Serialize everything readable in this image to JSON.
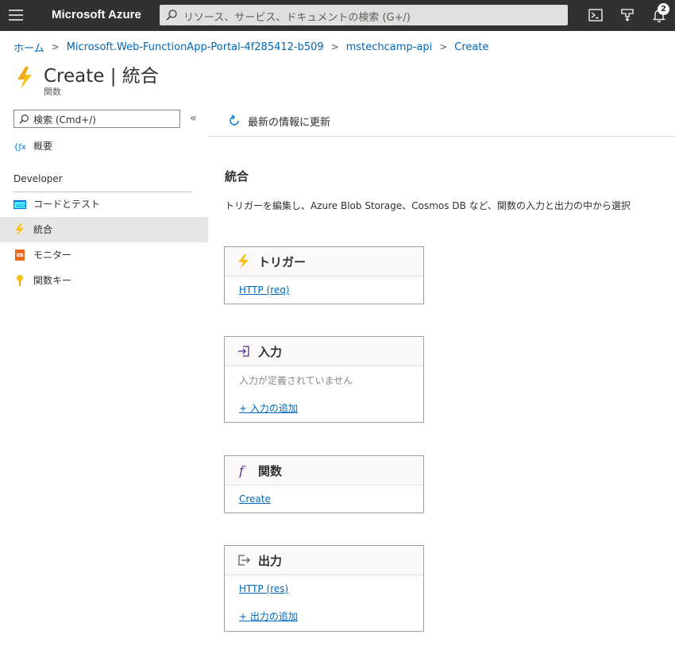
{
  "topbar": {
    "brand": "Microsoft Azure",
    "search_placeholder": "リソース、サービス、ドキュメントの検索 (G+/)",
    "notification_count": "2",
    "colors": {
      "bar": "#323130",
      "accent": "#0067b8"
    }
  },
  "breadcrumb": {
    "items": [
      "ホーム",
      "Microsoft.Web-FunctionApp-Portal-4f285412-b509",
      "mstechcamp-api",
      "Create"
    ]
  },
  "header": {
    "title": "Create | 統合",
    "subtitle": "関数",
    "icon": "lightning-icon"
  },
  "sidebar": {
    "search_placeholder": "検索 (Cmd+/)",
    "collapse_glyph": "«",
    "overview": {
      "label": "概要",
      "icon": "function-icon"
    },
    "section": "Developer",
    "items": [
      {
        "label": "コードとテスト",
        "icon": "code-icon"
      },
      {
        "label": "統合",
        "icon": "lightning-icon",
        "active": true
      },
      {
        "label": "モニター",
        "icon": "monitor-icon"
      },
      {
        "label": "関数キー",
        "icon": "key-icon"
      }
    ]
  },
  "toolbar": {
    "refresh_label": "最新の情報に更新",
    "refresh_icon": "refresh-icon"
  },
  "main": {
    "section_title": "統合",
    "description": "トリガーを編集し、Azure Blob Storage、Cosmos DB など、関数の入力と出力の中から選択",
    "cards": {
      "trigger": {
        "title": "トリガー",
        "icon": "lightning-icon",
        "link": "HTTP (req)"
      },
      "input": {
        "title": "入力",
        "icon": "input-icon",
        "empty": "入力が定義されていません",
        "add": "+ 入力の追加"
      },
      "function": {
        "title": "関数",
        "icon": "function-italic-icon",
        "link": "Create"
      },
      "output": {
        "title": "出力",
        "icon": "output-icon",
        "link": "HTTP (res)",
        "add": "+ 出力の追加"
      }
    }
  }
}
